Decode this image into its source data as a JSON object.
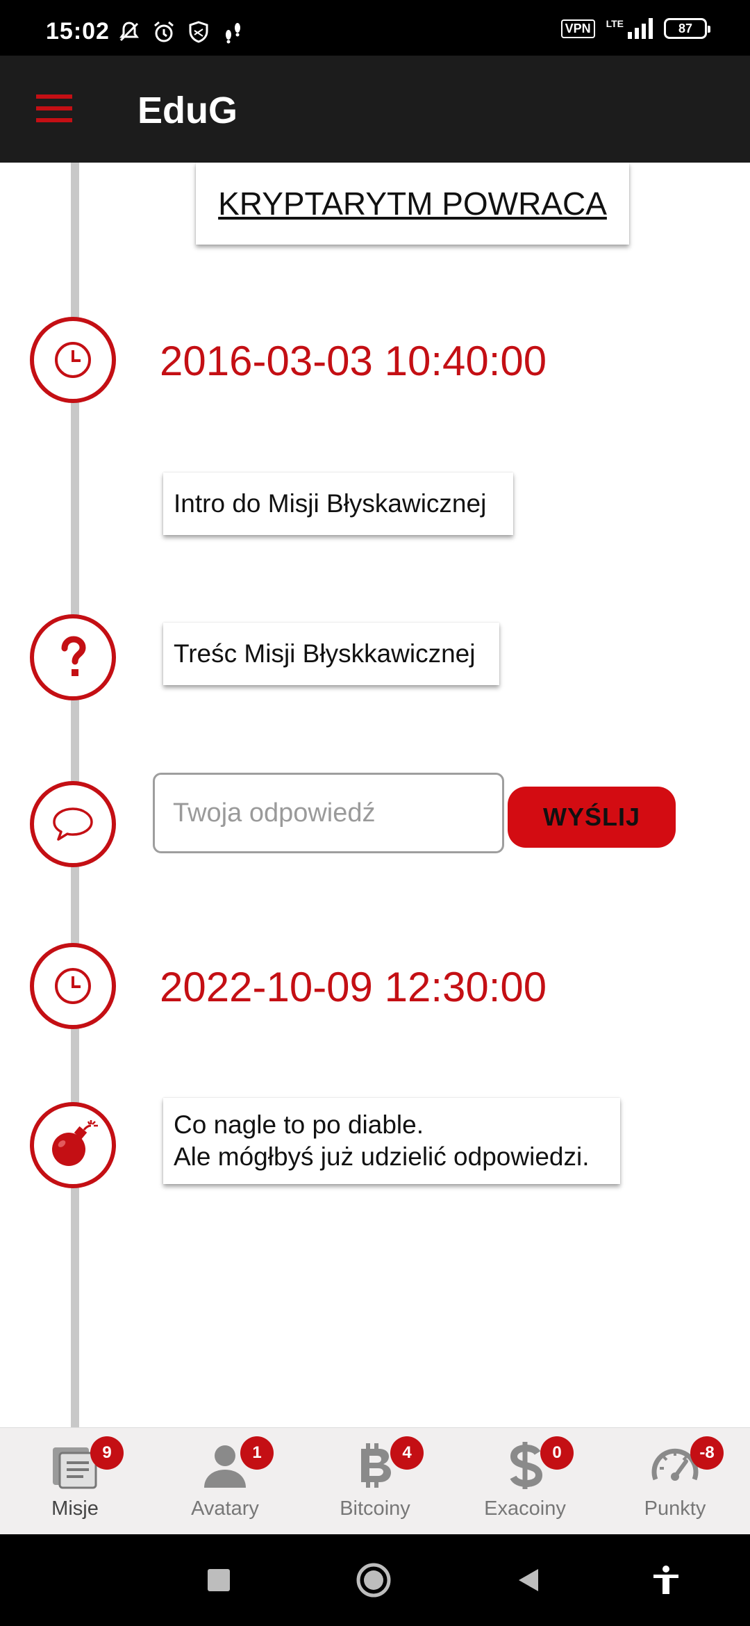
{
  "status_bar": {
    "time": "15:02",
    "vpn": "VPN",
    "network": "LTE",
    "battery": "87",
    "icons": [
      "mute-bell-icon",
      "alarm-icon",
      "shield-icon",
      "steps-icon"
    ]
  },
  "app_bar": {
    "title": "EduG",
    "menu_icon": "hamburger-menu-icon"
  },
  "mission": {
    "title": "KRYPTARYTM POWRACA",
    "start_time": "2016-03-03 10:40:00",
    "intro": "Intro do Misji Błyskawicznej",
    "content": "Treśc Misji Błyskkawicznej",
    "answer_placeholder": "Twoja odpowiedź",
    "send_label": "WYŚLIJ",
    "end_time": "2022-10-09 12:30:00",
    "hint_line1": "Co nagle to po diable.",
    "hint_line2": "Ale mógłbyś już udzielić odpowiedzi."
  },
  "bottom_nav": {
    "items": [
      {
        "label": "Misje",
        "badge": "9",
        "icon": "missions-icon"
      },
      {
        "label": "Avatary",
        "badge": "1",
        "icon": "avatar-icon"
      },
      {
        "label": "Bitcoiny",
        "badge": "4",
        "icon": "bitcoin-icon"
      },
      {
        "label": "Exacoiny",
        "badge": "0",
        "icon": "dollar-icon"
      },
      {
        "label": "Punkty",
        "badge": "-8",
        "icon": "speedometer-icon"
      }
    ]
  },
  "colors": {
    "accent": "#c40f14",
    "app_bar": "#1c1c1c",
    "timeline": "#c8c8c8"
  }
}
